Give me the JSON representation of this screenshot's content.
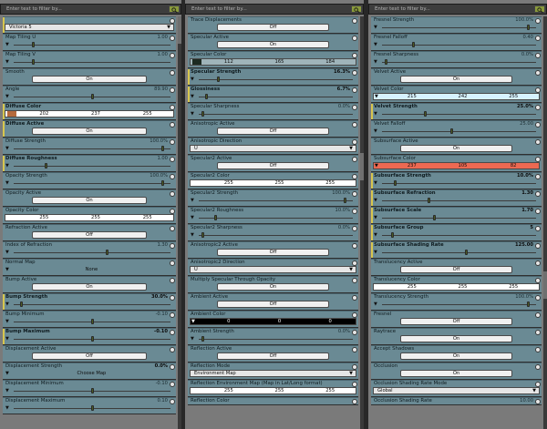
{
  "filter_placeholder": "Enter text to filter by...",
  "col0": [
    {
      "label": "",
      "ctrl": "combo",
      "value": "Victoria 5",
      "hl": true
    },
    {
      "label": "Map Tiling U",
      "value": "1.00",
      "ctrl": "slider",
      "k": 0.12
    },
    {
      "label": "Map Tiling V",
      "value": "1.00",
      "ctrl": "slider",
      "k": 0.12
    },
    {
      "label": "Smooth",
      "ctrl": "button",
      "button": "On"
    },
    {
      "label": "Angle",
      "value": "89.90",
      "ctrl": "slider",
      "k": 0.5
    },
    {
      "label": "Diffuse Color",
      "ctrl": "color",
      "rgb": [
        "202",
        "237",
        "255"
      ],
      "swatch": "#b56a3c",
      "hl": true
    },
    {
      "label": "Diffuse Active",
      "ctrl": "button",
      "button": "On",
      "hl": true
    },
    {
      "label": "Diffuse Strength",
      "value": "100.0%",
      "ctrl": "slider",
      "k": 0.96
    },
    {
      "label": "Diffuse Roughness",
      "value": "1.00",
      "ctrl": "slider",
      "k": 0.2,
      "hl": true
    },
    {
      "label": "Opacity Strength",
      "value": "100.0%",
      "ctrl": "slider",
      "k": 0.96
    },
    {
      "label": "Opacity Active",
      "ctrl": "button",
      "button": "On"
    },
    {
      "label": "Opacity Color",
      "ctrl": "color",
      "rgb": [
        "255",
        "255",
        "255"
      ],
      "swatch": "#ffffff"
    },
    {
      "label": "Refraction Active",
      "ctrl": "button",
      "button": "Off"
    },
    {
      "label": "Index of Refraction",
      "value": "1.30",
      "ctrl": "slider",
      "k": 0.6
    },
    {
      "label": "Normal Map",
      "ctrl": "map",
      "map": "None"
    },
    {
      "label": "Bump Active",
      "ctrl": "button",
      "button": "On"
    },
    {
      "label": "Bump Strength",
      "value": "30.0%",
      "vb": true,
      "ctrl": "slider",
      "k": 0.04,
      "hl": true
    },
    {
      "label": "Bump Minimum",
      "value": "-0.10",
      "ctrl": "slider",
      "k": 0.5
    },
    {
      "label": "Bump Maximum",
      "value": "-0.10",
      "vb": true,
      "ctrl": "slider",
      "k": 0.5,
      "hl": true
    },
    {
      "label": "Displacement Active",
      "ctrl": "button",
      "button": "Off"
    },
    {
      "label": "Displacement Strength",
      "value": "0.0%",
      "vb": true,
      "ctrl": "map",
      "map": "Choose Map"
    },
    {
      "label": "Displacement Minimum",
      "value": "-0.10",
      "ctrl": "slider",
      "k": 0.5
    },
    {
      "label": "Displacement Maximum",
      "value": "0.10",
      "ctrl": "slider",
      "k": 0.5
    }
  ],
  "col1": [
    {
      "label": "Trace Displacements",
      "ctrl": "button",
      "button": "Off"
    },
    {
      "label": "Specular Active",
      "ctrl": "button",
      "button": "On"
    },
    {
      "label": "Specular Color",
      "ctrl": "color",
      "rgb": [
        "112",
        "165",
        "184"
      ],
      "swatch": "#1c2a22",
      "dark": true
    },
    {
      "label": "Specular Strength",
      "value": "16.3%",
      "vb": true,
      "ctrl": "slider",
      "k": 0.12,
      "hl": true
    },
    {
      "label": "Glossiness",
      "value": "6.7%",
      "vb": true,
      "ctrl": "slider",
      "k": 0.04,
      "hl": true
    },
    {
      "label": "Specular Sharpness",
      "value": "0.0%",
      "ctrl": "slider",
      "k": 0.02
    },
    {
      "label": "Anisotropic Active",
      "ctrl": "button",
      "button": "Off"
    },
    {
      "label": "Anisotropic Direction",
      "ctrl": "combo",
      "value": "U"
    },
    {
      "label": "Specular2 Active",
      "ctrl": "button",
      "button": "Off"
    },
    {
      "label": "Specular2 Color",
      "ctrl": "color",
      "rgb": [
        "255",
        "255",
        "255"
      ],
      "swatch": "#ffffff"
    },
    {
      "label": "Specular2 Strength",
      "value": "100.0%",
      "ctrl": "slider",
      "k": 0.96
    },
    {
      "label": "Specular2 Roughness",
      "value": "10.0%",
      "ctrl": "slider",
      "k": 0.1
    },
    {
      "label": "Specular2 Sharpness",
      "value": "0.0%",
      "ctrl": "slider",
      "k": 0.02
    },
    {
      "label": "Anisotropic2 Active",
      "ctrl": "button",
      "button": "Off"
    },
    {
      "label": "Anisotropic2 Direction",
      "ctrl": "combo",
      "value": "U"
    },
    {
      "label": "Multiply Specular Through Opacity",
      "ctrl": "button",
      "button": "On"
    },
    {
      "label": "Ambient Active",
      "ctrl": "button",
      "button": "Off"
    },
    {
      "label": "Ambient Color",
      "ctrl": "color",
      "rgb": [
        "0",
        "0",
        "0"
      ],
      "swatch": "#000000",
      "black": true
    },
    {
      "label": "Ambient Strength",
      "value": "0.0%",
      "ctrl": "slider",
      "k": 0.02
    },
    {
      "label": "Reflection Active",
      "ctrl": "button",
      "button": "Off"
    },
    {
      "label": "Reflection Mode",
      "ctrl": "combo",
      "value": "Environment Map"
    },
    {
      "label": "Reflection Environment Map (Map in Lat/Long format)",
      "ctrl": "color",
      "rgb": [
        "255",
        "255",
        "255"
      ],
      "swatch": "#ffffff"
    },
    {
      "label": "Reflection Color",
      "ctrl": "none"
    }
  ],
  "col2": [
    {
      "label": "Fresnel Strength",
      "value": "100.0%",
      "ctrl": "slider",
      "k": 0.96
    },
    {
      "label": "Fresnel Falloff",
      "value": "0.40",
      "ctrl": "slider",
      "k": 0.2
    },
    {
      "label": "Fresnel Sharpness",
      "value": "0.0%",
      "ctrl": "slider",
      "k": 0.02
    },
    {
      "label": "Velvet Active",
      "ctrl": "button",
      "button": "On"
    },
    {
      "label": "Velvet Color",
      "ctrl": "color",
      "rgb": [
        "215",
        "242",
        "255"
      ],
      "swatch": "#d7f2ff",
      "light": true
    },
    {
      "label": "Velvet Strength",
      "value": "25.0%",
      "vb": true,
      "ctrl": "slider",
      "k": 0.28,
      "hl": true
    },
    {
      "label": "Velvet Falloff",
      "value": "25.00",
      "ctrl": "slider",
      "k": 0.45
    },
    {
      "label": "Subsurface Active",
      "ctrl": "button",
      "button": "On"
    },
    {
      "label": "Subsurface Color",
      "ctrl": "color",
      "rgb": [
        "237",
        "105",
        "82"
      ],
      "swatch": "#ed6952",
      "red": true
    },
    {
      "label": "Subsurface Strength",
      "value": "10.0%",
      "vb": true,
      "ctrl": "slider",
      "k": 0.08,
      "hl": true
    },
    {
      "label": "Subsurface Refraction",
      "value": "1.30",
      "vb": true,
      "ctrl": "slider",
      "k": 0.3,
      "hl": true
    },
    {
      "label": "Subsurface Scale",
      "value": "1.70",
      "vb": true,
      "ctrl": "slider",
      "k": 0.34,
      "hl": true
    },
    {
      "label": "Subsurface Group",
      "value": "5",
      "vb": true,
      "ctrl": "slider",
      "k": 0.06,
      "hl": true
    },
    {
      "label": "Subsurface Shading Rate",
      "value": "125.00",
      "vb": true,
      "ctrl": "slider",
      "k": 0.55,
      "hl": true
    },
    {
      "label": "Translucency Active",
      "ctrl": "button",
      "button": "Off"
    },
    {
      "label": "Translucency Color",
      "ctrl": "color",
      "rgb": [
        "255",
        "255",
        "255"
      ],
      "swatch": "#ffffff"
    },
    {
      "label": "Translucency Strength",
      "value": "100.0%",
      "ctrl": "slider",
      "k": 0.96
    },
    {
      "label": "Fresnel",
      "ctrl": "button",
      "button": "Off"
    },
    {
      "label": "Raytrace",
      "ctrl": "button",
      "button": "On"
    },
    {
      "label": "Accept Shadows",
      "ctrl": "button",
      "button": "On"
    },
    {
      "label": "Occlusion",
      "ctrl": "button",
      "button": "On"
    },
    {
      "label": "Occlusion Shading Rate Mode",
      "ctrl": "combo",
      "value": "Global"
    },
    {
      "label": "Occlusion Shading Rate",
      "value": "10.00",
      "ctrl": "none"
    }
  ]
}
